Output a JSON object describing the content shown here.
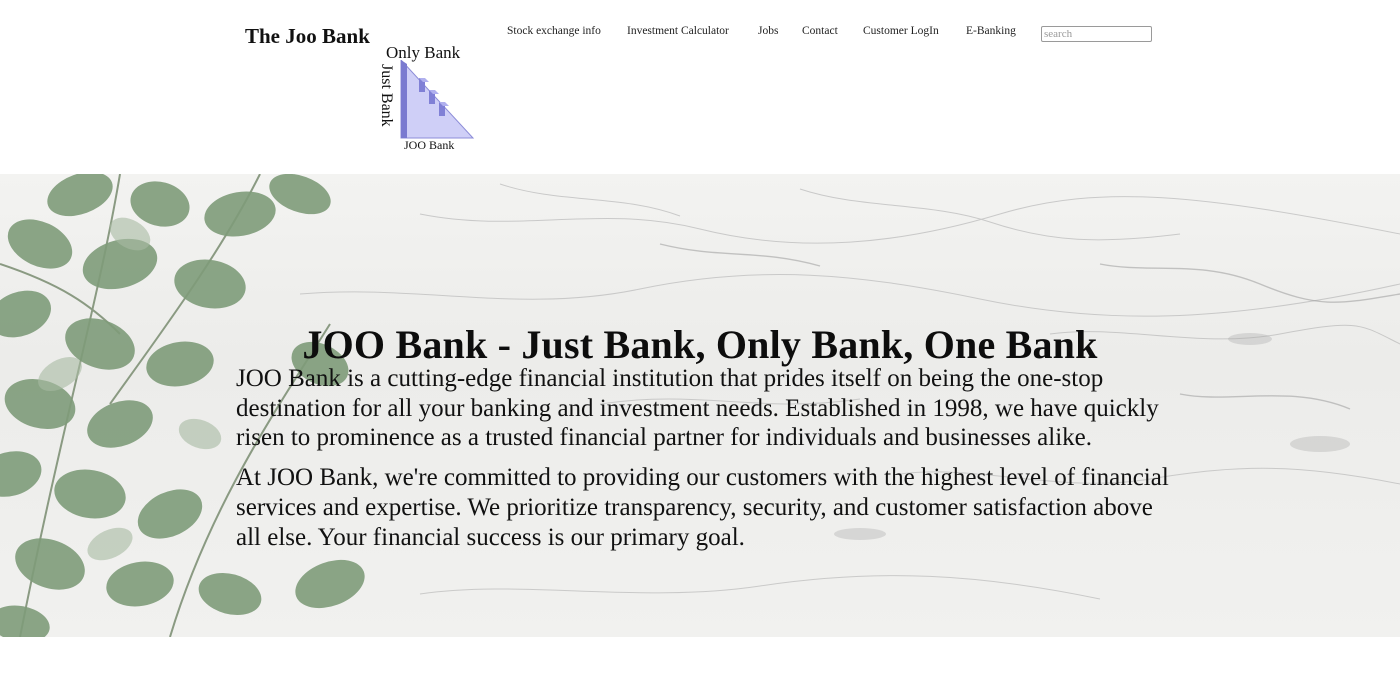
{
  "header": {
    "brand_name": "The Joo Bank",
    "logo": {
      "top_text": "Only Bank",
      "side_text": "Just Bank",
      "bottom_text": "JOO Bank",
      "color": "#c9c9f5"
    },
    "nav": [
      {
        "label": "Stock exchange info"
      },
      {
        "label": "Investment Calculator"
      },
      {
        "label": "Jobs"
      },
      {
        "label": "Contact"
      },
      {
        "label": "Customer LogIn"
      },
      {
        "label": "E-Banking"
      }
    ],
    "search": {
      "placeholder": "search",
      "value": ""
    }
  },
  "hero": {
    "title": "JOO Bank - Just Bank, Only Bank, One Bank",
    "paragraphs": [
      "JOO Bank is a cutting-edge financial institution that prides itself on being the one-stop destination for all your banking and investment needs. Established in 1998, we have quickly risen to prominence as a trusted financial partner for individuals and businesses alike.",
      "At JOO Bank, we're committed to providing our customers with the highest level of financial services and expertise. We prioritize transparency, security, and customer satisfaction above all else. Your financial success is our primary goal."
    ],
    "background": "marble-with-eucalyptus-leaves",
    "leaf_color": "#7f9c7a"
  }
}
